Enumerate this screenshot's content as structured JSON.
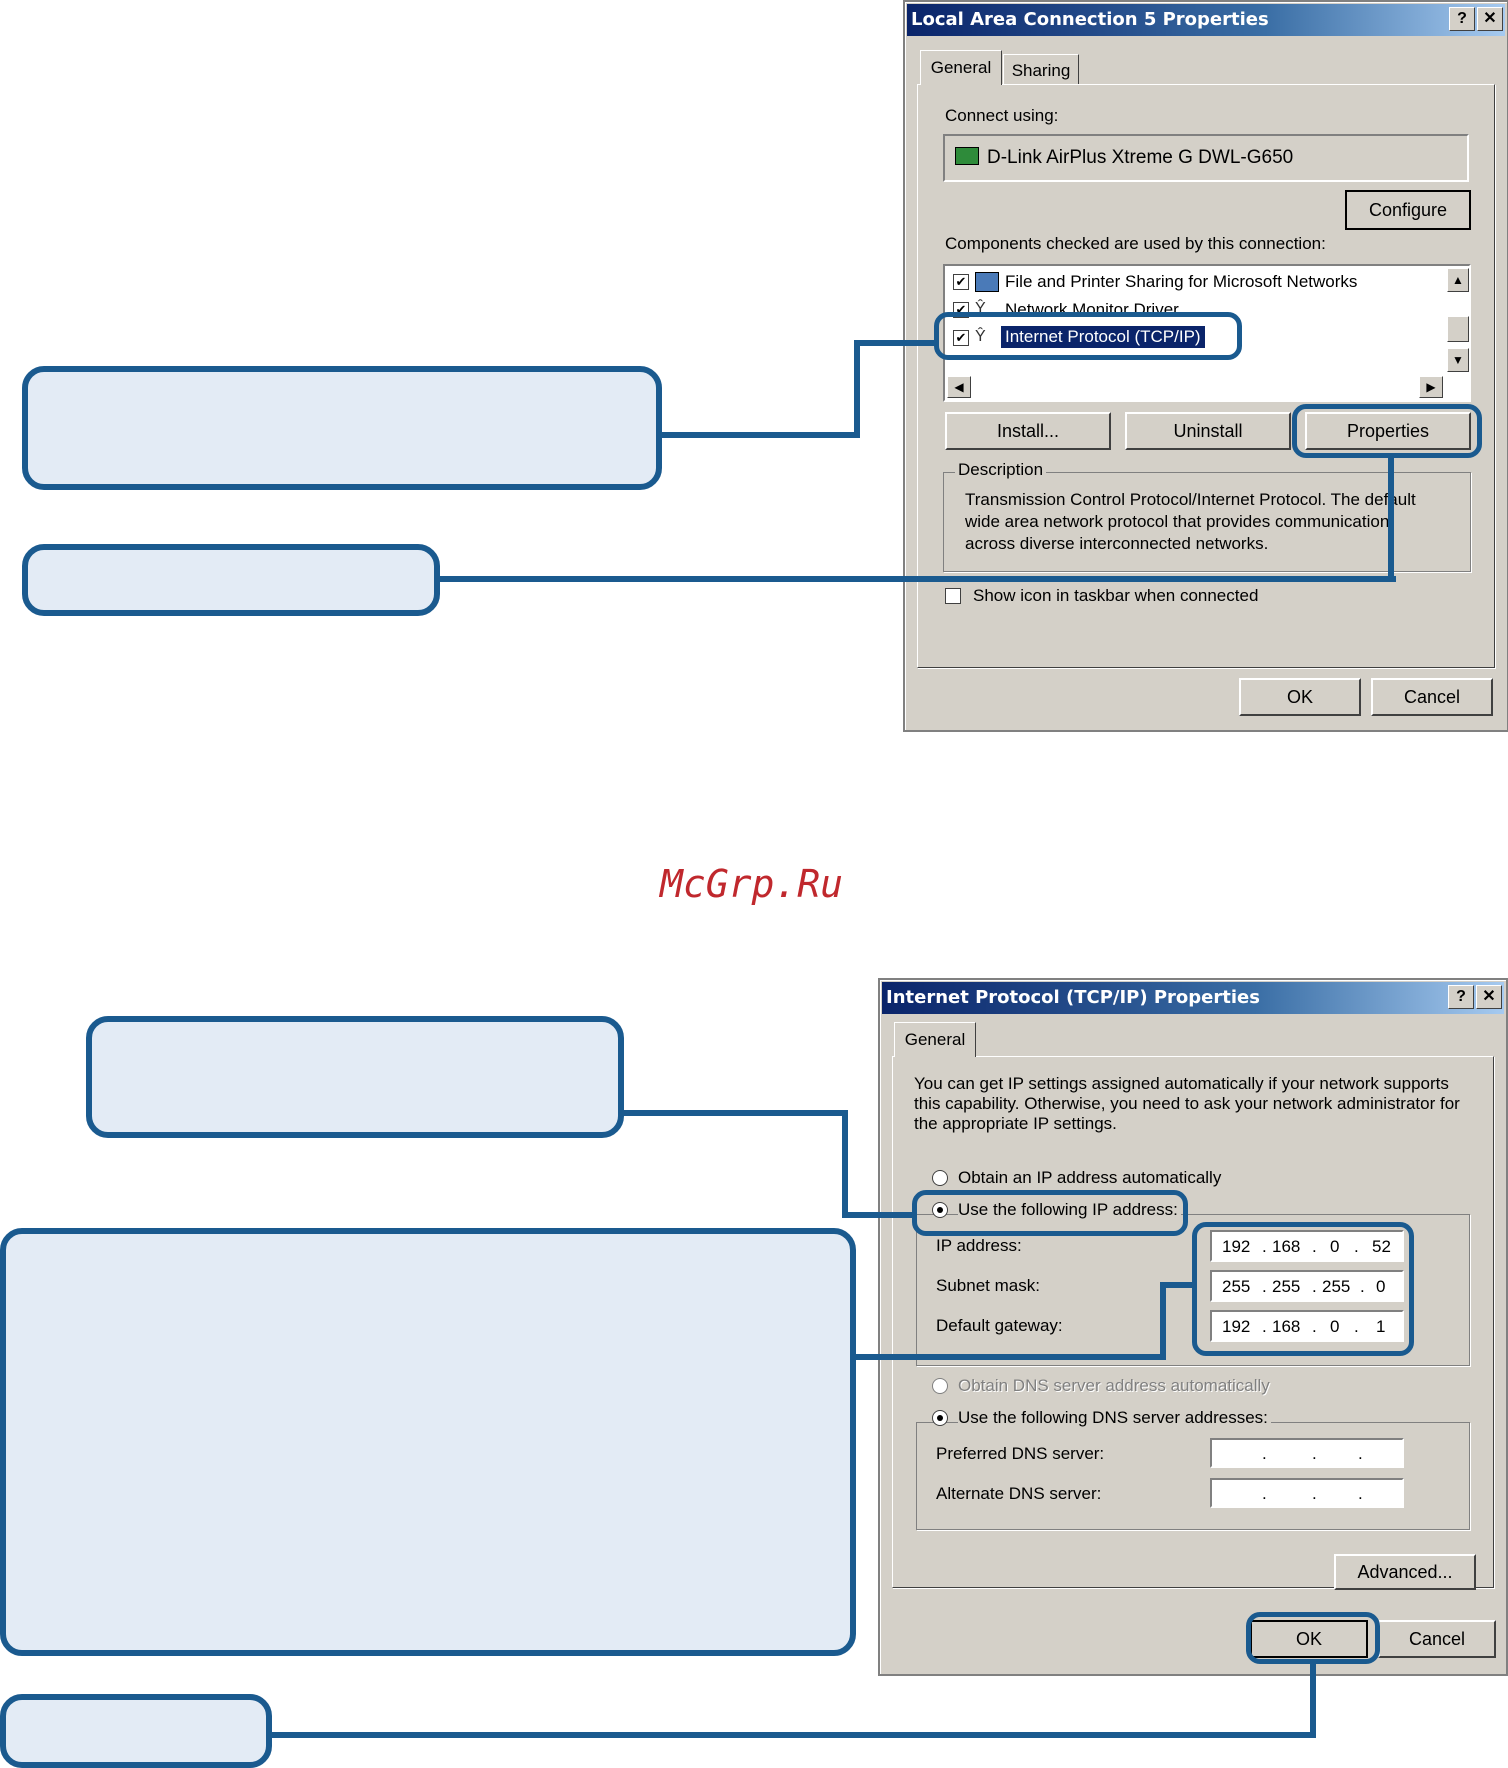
{
  "dialog1": {
    "title": "Local Area Connection 5 Properties",
    "help_btn": "?",
    "close_btn": "✕",
    "tabs": [
      "General",
      "Sharing"
    ],
    "connect_using_label": "Connect using:",
    "adapter_name": "D-Link AirPlus Xtreme G DWL-G650",
    "configure_btn": "Configure",
    "components_label": "Components checked are used by this connection:",
    "components": [
      {
        "label": "File and Printer Sharing for Microsoft Networks",
        "checked": true
      },
      {
        "label": "Network Monitor Driver",
        "checked": true
      },
      {
        "label": "Internet Protocol (TCP/IP)",
        "checked": true
      }
    ],
    "install_btn": "Install...",
    "uninstall_btn": "Uninstall",
    "properties_btn": "Properties",
    "description_label": "Description",
    "description_lines": [
      "Transmission Control Protocol/Internet Protocol. The default",
      "wide area network protocol that provides communication",
      "across diverse interconnected networks."
    ],
    "show_icon_label": "Show icon in taskbar when connected",
    "ok_btn": "OK",
    "cancel_btn": "Cancel"
  },
  "watermark": "McGrp.Ru",
  "dialog2": {
    "title": "Internet Protocol (TCP/IP) Properties",
    "help_btn": "?",
    "close_btn": "✕",
    "tab": "General",
    "intro_lines": [
      "You can get IP settings assigned automatically if your network supports",
      "this capability. Otherwise, you need to ask your network administrator for",
      "the appropriate IP settings."
    ],
    "obtain_ip_label": "Obtain an IP address automatically",
    "use_ip_label": "Use the following IP address:",
    "ip_address_label": "IP address:",
    "ip_address": [
      "192",
      "168",
      "0",
      "52"
    ],
    "subnet_label": "Subnet mask:",
    "subnet": [
      "255",
      "255",
      "255",
      "0"
    ],
    "gateway_label": "Default gateway:",
    "gateway": [
      "192",
      "168",
      "0",
      "1"
    ],
    "obtain_dns_label": "Obtain DNS server address automatically",
    "use_dns_label": "Use the following DNS server addresses:",
    "preferred_dns_label": "Preferred DNS server:",
    "alternate_dns_label": "Alternate DNS server:",
    "advanced_btn": "Advanced...",
    "ok_btn": "OK",
    "cancel_btn": "Cancel"
  },
  "colors": {
    "callout_border": "#1a5a8f",
    "callout_fill": "#e3ebf5",
    "watermark": "#c0282d"
  }
}
